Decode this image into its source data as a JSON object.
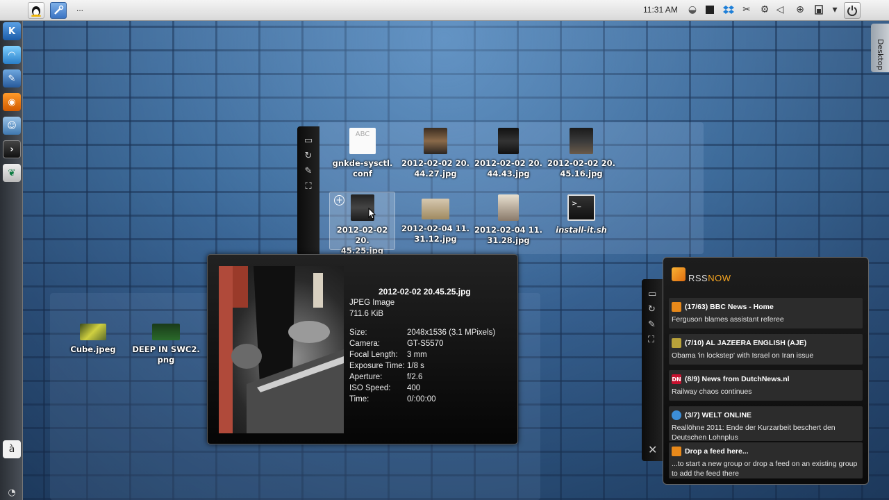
{
  "top_panel": {
    "overflow_label": "...",
    "clock": "11:31 AM"
  },
  "desktop_tab": {
    "label": "Desktop"
  },
  "left_dock": {
    "bottom_char": "à"
  },
  "folderview_top": {
    "files": [
      {
        "name": "gnkde-sysctl.conf",
        "label1": "gnkde-sysctl.",
        "label2": "conf",
        "thumb_text": "ABC"
      },
      {
        "name": "2012-02-02 20.44.27.jpg",
        "label1": "2012-02-02 20.",
        "label2": "44.27.jpg"
      },
      {
        "name": "2012-02-02 20.44.43.jpg",
        "label1": "2012-02-02 20.",
        "label2": "44.43.jpg"
      },
      {
        "name": "2012-02-02 20.45.16.jpg",
        "label1": "2012-02-02 20.",
        "label2": "45.16.jpg"
      },
      {
        "name": "2012-02-02 20.45.25.jpg",
        "label1": "2012-02-02 20.",
        "label2": "45.25.jpg"
      },
      {
        "name": "2012-02-04 11.31.12.jpg",
        "label1": "2012-02-04 11.",
        "label2": "31.12.jpg"
      },
      {
        "name": "2012-02-04 11.31.28.jpg",
        "label1": "2012-02-04 11.",
        "label2": "31.28.jpg"
      },
      {
        "name": "install-it.sh",
        "label1": "install-it.sh",
        "label2": "",
        "thumb_text": ">_"
      }
    ]
  },
  "folderview_bottom": {
    "files": [
      {
        "label1": "Cube.jpeg",
        "label2": ""
      },
      {
        "label1": "DEEP IN SWC2.",
        "label2": "png"
      }
    ]
  },
  "tooltip": {
    "title": "2012-02-02 20.45.25.jpg",
    "type": "JPEG Image",
    "size_kib": "711.6 KiB",
    "rows": [
      {
        "key": "Size:",
        "value": "2048x1536 (3.1 MPixels)"
      },
      {
        "key": "Camera:",
        "value": "GT-S5570"
      },
      {
        "key": "Focal Length:",
        "value": "3 mm"
      },
      {
        "key": "Exposure Time:",
        "value": "1/8 s"
      },
      {
        "key": "Aperture:",
        "value": "f/2.6"
      },
      {
        "key": "ISO Speed:",
        "value": "400"
      },
      {
        "key": "Time:",
        "value": "0/:00:00"
      }
    ]
  },
  "rss": {
    "title_a": "RSS",
    "title_b": "NOW",
    "items": [
      {
        "heading": "(17/63) BBC News - Home",
        "body": "Ferguson blames assistant referee",
        "icon": "",
        "icon_color": "#e8891a"
      },
      {
        "heading": "(7/10) AL JAZEERA ENGLISH (AJE)",
        "body": "Obama 'in lockstep' with Israel on Iran issue",
        "icon": "",
        "icon_color": "#b9a23a"
      },
      {
        "heading": "(8/9) News from DutchNews.nl",
        "body": "Railway chaos continues",
        "icon": "DN",
        "icon_color": "#c8102e"
      },
      {
        "heading": "(3/7) WELT ONLINE",
        "body": "Reallöhne 2011: Ende der Kurzarbeit beschert den Deutschen Lohnplus",
        "icon": "",
        "icon_color": "#3c8ed8"
      },
      {
        "heading": "Drop a feed here...",
        "body": "...to start a new group or drop a feed on an existing group to add the feed there",
        "icon": "",
        "icon_color": "#e8891a"
      }
    ]
  }
}
